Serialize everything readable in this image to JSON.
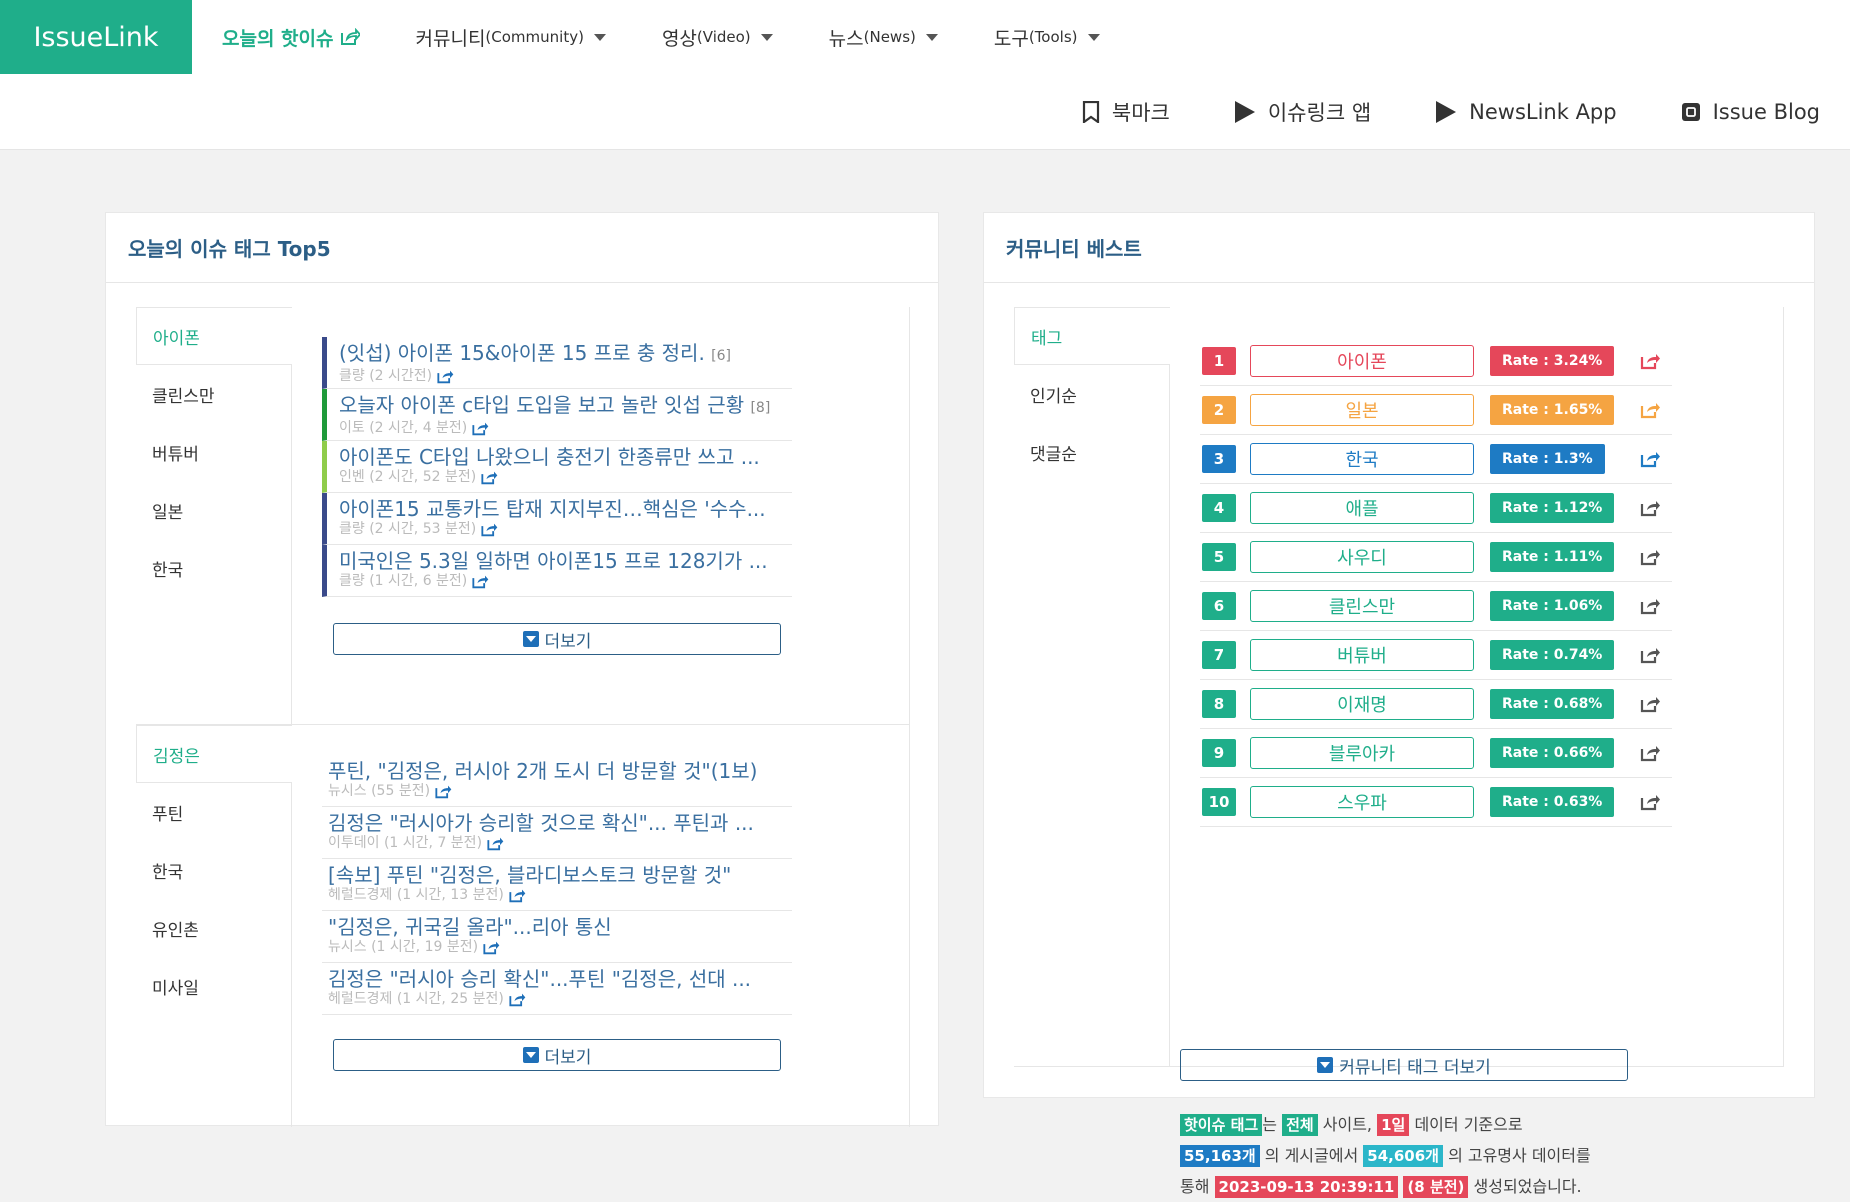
{
  "brand": {
    "name": "IssueLink"
  },
  "nav": [
    {
      "label": "오늘의 핫이슈",
      "sub": "",
      "active": true,
      "external": true
    },
    {
      "label": "커뮤니티",
      "sub": "(Community)",
      "active": false
    },
    {
      "label": "영상",
      "sub": "(Video)",
      "active": false
    },
    {
      "label": "뉴스",
      "sub": "(News)",
      "active": false
    },
    {
      "label": "도구",
      "sub": "(Tools)",
      "active": false
    }
  ],
  "sublinks": [
    {
      "label": "북마크",
      "icon": "bookmark-icon"
    },
    {
      "label": "이슈링크 앱",
      "icon": "play-store-icon"
    },
    {
      "label": "NewsLink App",
      "icon": "play-store-icon"
    },
    {
      "label": "Issue Blog",
      "icon": "blog-icon"
    }
  ],
  "left": {
    "title": "오늘의 이슈 태그 Top5",
    "more_label": "더보기",
    "group1": {
      "tags": [
        "아이폰",
        "클린스만",
        "버튜버",
        "일본",
        "한국"
      ],
      "articles": [
        {
          "title": "(잇섭) 아이폰 15&아이폰 15 프로 충 정리.",
          "count": "[6]",
          "meta": "클량 (2 시간전)",
          "color": "#3a4a8a"
        },
        {
          "title": "오늘자 아이폰 c타입 도입을 보고 놀란 잇섭 근황",
          "count": "[8]",
          "meta": "이토 (2 시간, 4 분전)",
          "color": "#1f9a3a"
        },
        {
          "title": "아이폰도 C타입 나왔으니 충전기 한종류만 쓰고 ...",
          "count": "",
          "meta": "인벤 (2 시간, 52 분전)",
          "color": "#8fcc4a"
        },
        {
          "title": "아이폰15 교통카드 탑재 지지부진…핵심은 '수수...",
          "count": "",
          "meta": "클량 (2 시간, 53 분전)",
          "color": "#3a4a8a"
        },
        {
          "title": "미국인은 5.3일 일하면 아이폰15 프로 128기가 ...",
          "count": "",
          "meta": "클량 (1 시간, 6 분전)",
          "color": "#3a4a8a"
        }
      ]
    },
    "group2": {
      "tags": [
        "김정은",
        "푸틴",
        "한국",
        "유인촌",
        "미사일"
      ],
      "articles": [
        {
          "title": "푸틴, \"김정은, 러시아 2개 도시 더 방문할 것\"(1보)",
          "meta": "뉴시스 (55 분전)"
        },
        {
          "title": "김정은 \"러시아가 승리할 것으로 확신\"... 푸틴과 ...",
          "meta": "이투데이 (1 시간, 7 분전)"
        },
        {
          "title": "[속보] 푸틴 \"김정은, 블라디보스토크 방문할 것\"",
          "meta": "헤럴드경제 (1 시간, 13 분전)"
        },
        {
          "title": "\"김정은, 귀국길 올라\"...리아 통신",
          "meta": "뉴시스 (1 시간, 19 분전)"
        },
        {
          "title": "김정은 \"러시아 승리 확신\"...푸틴 \"김정은, 선대 ...",
          "meta": "헤럴드경제 (1 시간, 25 분전)"
        }
      ]
    }
  },
  "right": {
    "title": "커뮤니티 베스트",
    "sort_tabs": [
      "태그",
      "인기순",
      "댓글순"
    ],
    "ranks": [
      {
        "rank": "1",
        "tag": "아이폰",
        "rate": "Rate : 3.24%",
        "color": "#e5475a"
      },
      {
        "rank": "2",
        "tag": "일본",
        "rate": "Rate : 1.65%",
        "color": "#f5a442"
      },
      {
        "rank": "3",
        "tag": "한국",
        "rate": "Rate : 1.3%",
        "color": "#1e7bc4"
      },
      {
        "rank": "4",
        "tag": "애플",
        "rate": "Rate : 1.12%",
        "color": "#1fae8a"
      },
      {
        "rank": "5",
        "tag": "사우디",
        "rate": "Rate : 1.11%",
        "color": "#1fae8a"
      },
      {
        "rank": "6",
        "tag": "클린스만",
        "rate": "Rate : 1.06%",
        "color": "#1fae8a"
      },
      {
        "rank": "7",
        "tag": "버튜버",
        "rate": "Rate : 0.74%",
        "color": "#1fae8a"
      },
      {
        "rank": "8",
        "tag": "이재명",
        "rate": "Rate : 0.68%",
        "color": "#1fae8a"
      },
      {
        "rank": "9",
        "tag": "블루아카",
        "rate": "Rate : 0.66%",
        "color": "#1fae8a"
      },
      {
        "rank": "10",
        "tag": "스우파",
        "rate": "Rate : 0.63%",
        "color": "#1fae8a"
      }
    ],
    "more_tag_label": "커뮤니티 태그 더보기",
    "info": {
      "hot_tag": "핫이슈 태그",
      "t1": "는",
      "all": "전체",
      "t2": "사이트,",
      "day": "1일",
      "t3": "데이터 기준으로",
      "posts": "55,163개",
      "t4": "의 게시글에서",
      "nouns": "54,606개",
      "t5": "의 고유명사 데이터를",
      "t6": "통해",
      "datetime": "2023-09-13 20:39:11",
      "ago": "(8 분전)",
      "t7": "생성되었습니다."
    }
  }
}
